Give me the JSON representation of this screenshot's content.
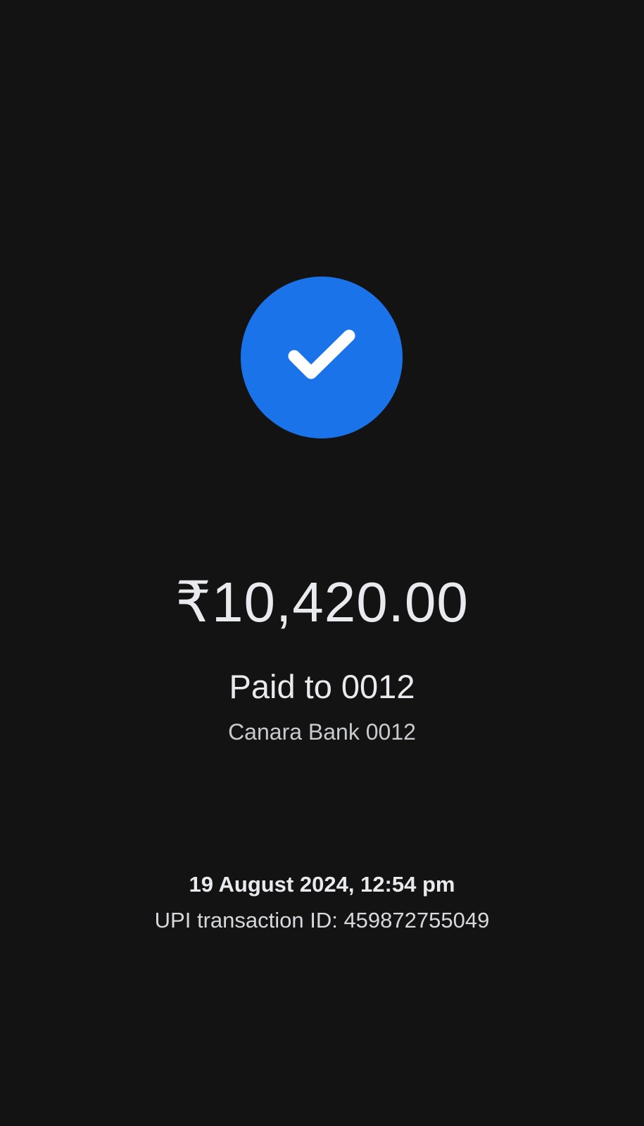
{
  "status": {
    "icon": "check-icon",
    "color": "#1a73e8"
  },
  "payment": {
    "amount": "₹10,420.00",
    "paid_to": "Paid to 0012",
    "bank": "Canara Bank 0012"
  },
  "transaction": {
    "datetime": "19 August 2024, 12:54 pm",
    "upi_id": "UPI transaction ID: 459872755049"
  }
}
